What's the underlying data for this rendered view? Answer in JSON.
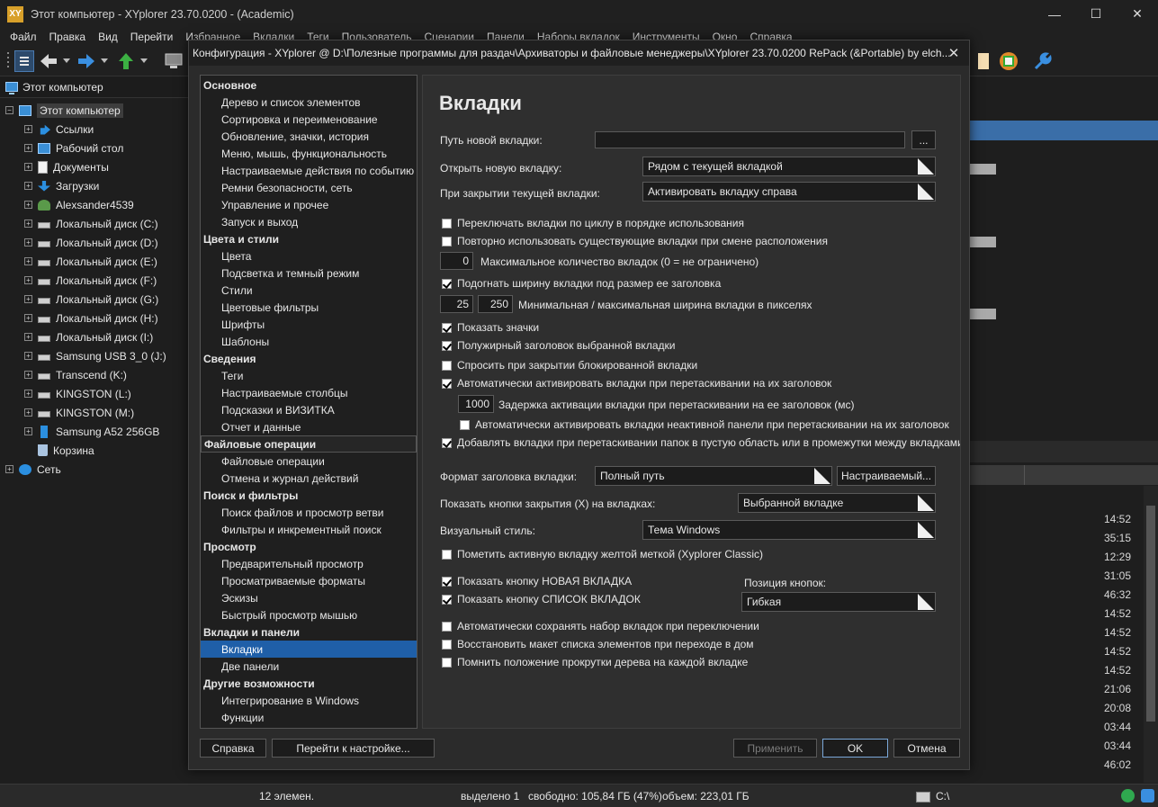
{
  "app": {
    "logo": "XY",
    "title": "Этот компьютер - XYplorer 23.70.0200 - (Academic)",
    "min": "—",
    "max": "☐",
    "close": "✕"
  },
  "menu": [
    "Файл",
    "Правка",
    "Вид",
    "Перейти",
    "Избранное",
    "Вкладки",
    "Теги",
    "Пользователь",
    "Сценарии",
    "Панели",
    "Наборы вкладок",
    "Инструменты",
    "Окно",
    "Справка"
  ],
  "address": "Этот компьютер",
  "tree": [
    {
      "label": "Этот компьютер",
      "icon": "pc-icon",
      "level": 0,
      "exp": "−",
      "sel": true
    },
    {
      "label": "Ссылки",
      "icon": "link-icon",
      "level": 1,
      "exp": "+"
    },
    {
      "label": "Рабочий стол",
      "icon": "desktop-icon",
      "level": 1,
      "exp": "+"
    },
    {
      "label": "Документы",
      "icon": "document-icon",
      "level": 1,
      "exp": "+"
    },
    {
      "label": "Загрузки",
      "icon": "download-icon",
      "level": 1,
      "exp": "+"
    },
    {
      "label": "Alexsander4539",
      "icon": "user-icon",
      "level": 1,
      "exp": "+"
    },
    {
      "label": "Локальный диск (C:)",
      "icon": "drive-icon",
      "level": 1,
      "exp": "+"
    },
    {
      "label": "Локальный диск (D:)",
      "icon": "drive-icon",
      "level": 1,
      "exp": "+"
    },
    {
      "label": "Локальный диск (E:)",
      "icon": "drive-icon",
      "level": 1,
      "exp": "+"
    },
    {
      "label": "Локальный диск (F:)",
      "icon": "drive-icon",
      "level": 1,
      "exp": "+"
    },
    {
      "label": "Локальный диск (G:)",
      "icon": "drive-icon",
      "level": 1,
      "exp": "+"
    },
    {
      "label": "Локальный диск (H:)",
      "icon": "drive-icon",
      "level": 1,
      "exp": "+"
    },
    {
      "label": "Локальный диск (I:)",
      "icon": "drive-icon",
      "level": 1,
      "exp": "+"
    },
    {
      "label": "Samsung USB 3_0 (J:)",
      "icon": "drive-icon",
      "level": 1,
      "exp": "+"
    },
    {
      "label": "Transcend (K:)",
      "icon": "drive-icon",
      "level": 1,
      "exp": "+"
    },
    {
      "label": "KINGSTON (L:)",
      "icon": "drive-icon",
      "level": 1,
      "exp": "+"
    },
    {
      "label": "KINGSTON (M:)",
      "icon": "drive-icon",
      "level": 1,
      "exp": "+"
    },
    {
      "label": "Samsung A52 256GB",
      "icon": "usb-icon",
      "level": 1,
      "exp": "+"
    },
    {
      "label": "Корзина",
      "icon": "recycle-bin-icon",
      "level": 1,
      "exp": ""
    },
    {
      "label": "Сеть",
      "icon": "network-icon",
      "level": 0,
      "exp": "+"
    }
  ],
  "times": [
    "14:52",
    "35:15",
    "12:29",
    "31:05",
    "46:32",
    "14:52",
    "14:52",
    "14:52",
    "14:52",
    "21:06",
    "20:08",
    "03:44",
    "03:44",
    "46:02"
  ],
  "status": {
    "count": "12 элемен.",
    "selected": "выделено 1",
    "free": "свободно: 105,84 ГБ (47%)",
    "volume": "объем: 223,01 ГБ",
    "drive": "C:\\"
  },
  "dialog": {
    "title": "Конфигурация - XYplorer @ D:\\Полезные программы для раздач\\Архиваторы и файловые менеджеры\\XYplorer 23.70.0200 RePack (&Portable) by elch...",
    "close": "✕",
    "nav": [
      {
        "label": "Основное",
        "group": true
      },
      {
        "label": "Дерево и список элементов"
      },
      {
        "label": "Сортировка и переименование"
      },
      {
        "label": "Обновление, значки, история"
      },
      {
        "label": "Меню, мышь, функциональность"
      },
      {
        "label": "Настраиваемые действия по событию"
      },
      {
        "label": "Ремни безопасности, сеть"
      },
      {
        "label": "Управление и прочее"
      },
      {
        "label": "Запуск и выход"
      },
      {
        "label": "Цвета и стили",
        "group": true
      },
      {
        "label": "Цвета"
      },
      {
        "label": "Подсветка и темный режим"
      },
      {
        "label": "Стили"
      },
      {
        "label": "Цветовые фильтры"
      },
      {
        "label": "Шрифты"
      },
      {
        "label": "Шаблоны"
      },
      {
        "label": "Сведения",
        "group": true
      },
      {
        "label": "Теги"
      },
      {
        "label": "Настраиваемые столбцы"
      },
      {
        "label": "Подсказки и ВИЗИТКА"
      },
      {
        "label": "Отчет и данные"
      },
      {
        "label": "Файловые операции",
        "group": true,
        "hl": true
      },
      {
        "label": "Файловые операции"
      },
      {
        "label": "Отмена и журнал действий"
      },
      {
        "label": "Поиск и фильтры",
        "group": true
      },
      {
        "label": "Поиск файлов и просмотр ветви"
      },
      {
        "label": "Фильтры и инкрементный поиск"
      },
      {
        "label": "Просмотр",
        "group": true
      },
      {
        "label": "Предварительный просмотр"
      },
      {
        "label": "Просматриваемые форматы"
      },
      {
        "label": "Эскизы"
      },
      {
        "label": "Быстрый просмотр мышью"
      },
      {
        "label": "Вкладки и панели",
        "group": true
      },
      {
        "label": "Вкладки",
        "sel": true
      },
      {
        "label": "Две панели"
      },
      {
        "label": "Другие возможности",
        "group": true
      },
      {
        "label": "Интегрирование в Windows"
      },
      {
        "label": "Функции"
      }
    ],
    "heading": "Вкладки",
    "new_tab_path_label": "Путь новой вкладки:",
    "new_tab_path_value": "",
    "browse_label": "...",
    "open_new_tab_label": "Открыть новую вкладку:",
    "open_new_tab_value": "Рядом с текущей вкладкой",
    "on_close_label": "При закрытии текущей вкладки:",
    "on_close_value": "Активировать вкладку справа",
    "opt_cycle": "Переключать вкладки по циклу в порядке использования",
    "opt_reuse": "Повторно использовать существующие вкладки при смене расположения",
    "max_tabs_value": "0",
    "max_tabs_label": "Максимальное количество вкладок (0 = не ограничено)",
    "opt_fit": "Подогнать ширину вкладки под размер ее заголовка",
    "min_width": "25",
    "max_width": "250",
    "width_label": "Минимальная / максимальная ширина вкладки в пикселях",
    "opt_icons": "Показать значки",
    "opt_bold": "Полужирный заголовок выбранной вкладки",
    "opt_ask_locked": "Спросить при закрытии блокированной вкладки",
    "opt_auto_activate": "Автоматически активировать вкладки при перетаскивании на их заголовок",
    "delay_value": "1000",
    "delay_label": "Задержка активации вкладки при перетаскивании на ее заголовок (мс)",
    "opt_inactive_panel": "Автоматически активировать вкладки неактивной панели при перетаскивании на их заголовок",
    "opt_add_tabs": "Добавлять вкладки при перетаскивании папок в пустую область или в промежутки между вкладками",
    "caption_format_label": "Формат заголовка вкладки:",
    "caption_format_value": "Полный путь",
    "custom_btn": "Настраиваемый...",
    "close_buttons_label": "Показать кнопки закрытия (X) на вкладках:",
    "close_buttons_value": "Выбранной вкладке",
    "visual_style_label": "Визуальный стиль:",
    "visual_style_value": "Тема Windows",
    "opt_yellow": "Пометить активную вкладку желтой меткой (Xyplorer Classic)",
    "opt_new_tab_btn": "Показать кнопку НОВАЯ ВКЛАДКА",
    "opt_list_btn": "Показать кнопку СПИСОК ВКЛАДОК",
    "btn_pos_label": "Позиция кнопок:",
    "btn_pos_value": "Гибкая",
    "opt_autosave": "Автоматически сохранять набор вкладок при переключении",
    "opt_restore": "Восстановить макет списка элементов при переходе в дом",
    "opt_scroll": "Помнить положение прокрутки дерева на каждой вкладке",
    "help_btn": "Справка",
    "goto_btn": "Перейти к настройке...",
    "apply_btn": "Применить",
    "ok_btn": "OK",
    "cancel_btn": "Отмена"
  }
}
